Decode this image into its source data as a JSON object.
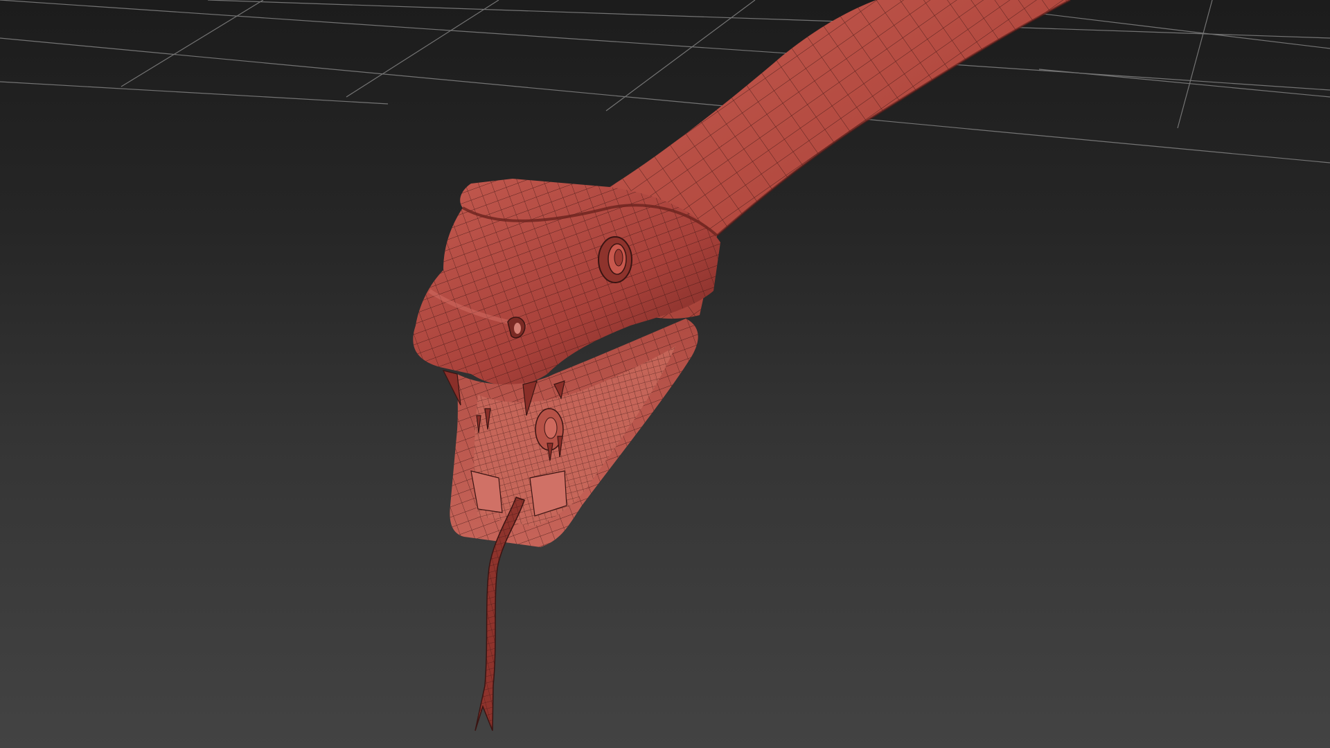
{
  "viewport": {
    "background_top": "#1c1c1c",
    "background_bottom": "#434343",
    "grid_color": "#8a8a8a"
  },
  "model": {
    "base_color": "#b5483f",
    "shadow_color": "#6e2420",
    "highlight_color": "#cf6358",
    "wire_color": "#3a1412",
    "mouth_color": "#a9463e",
    "display_mode": "edged faces"
  }
}
